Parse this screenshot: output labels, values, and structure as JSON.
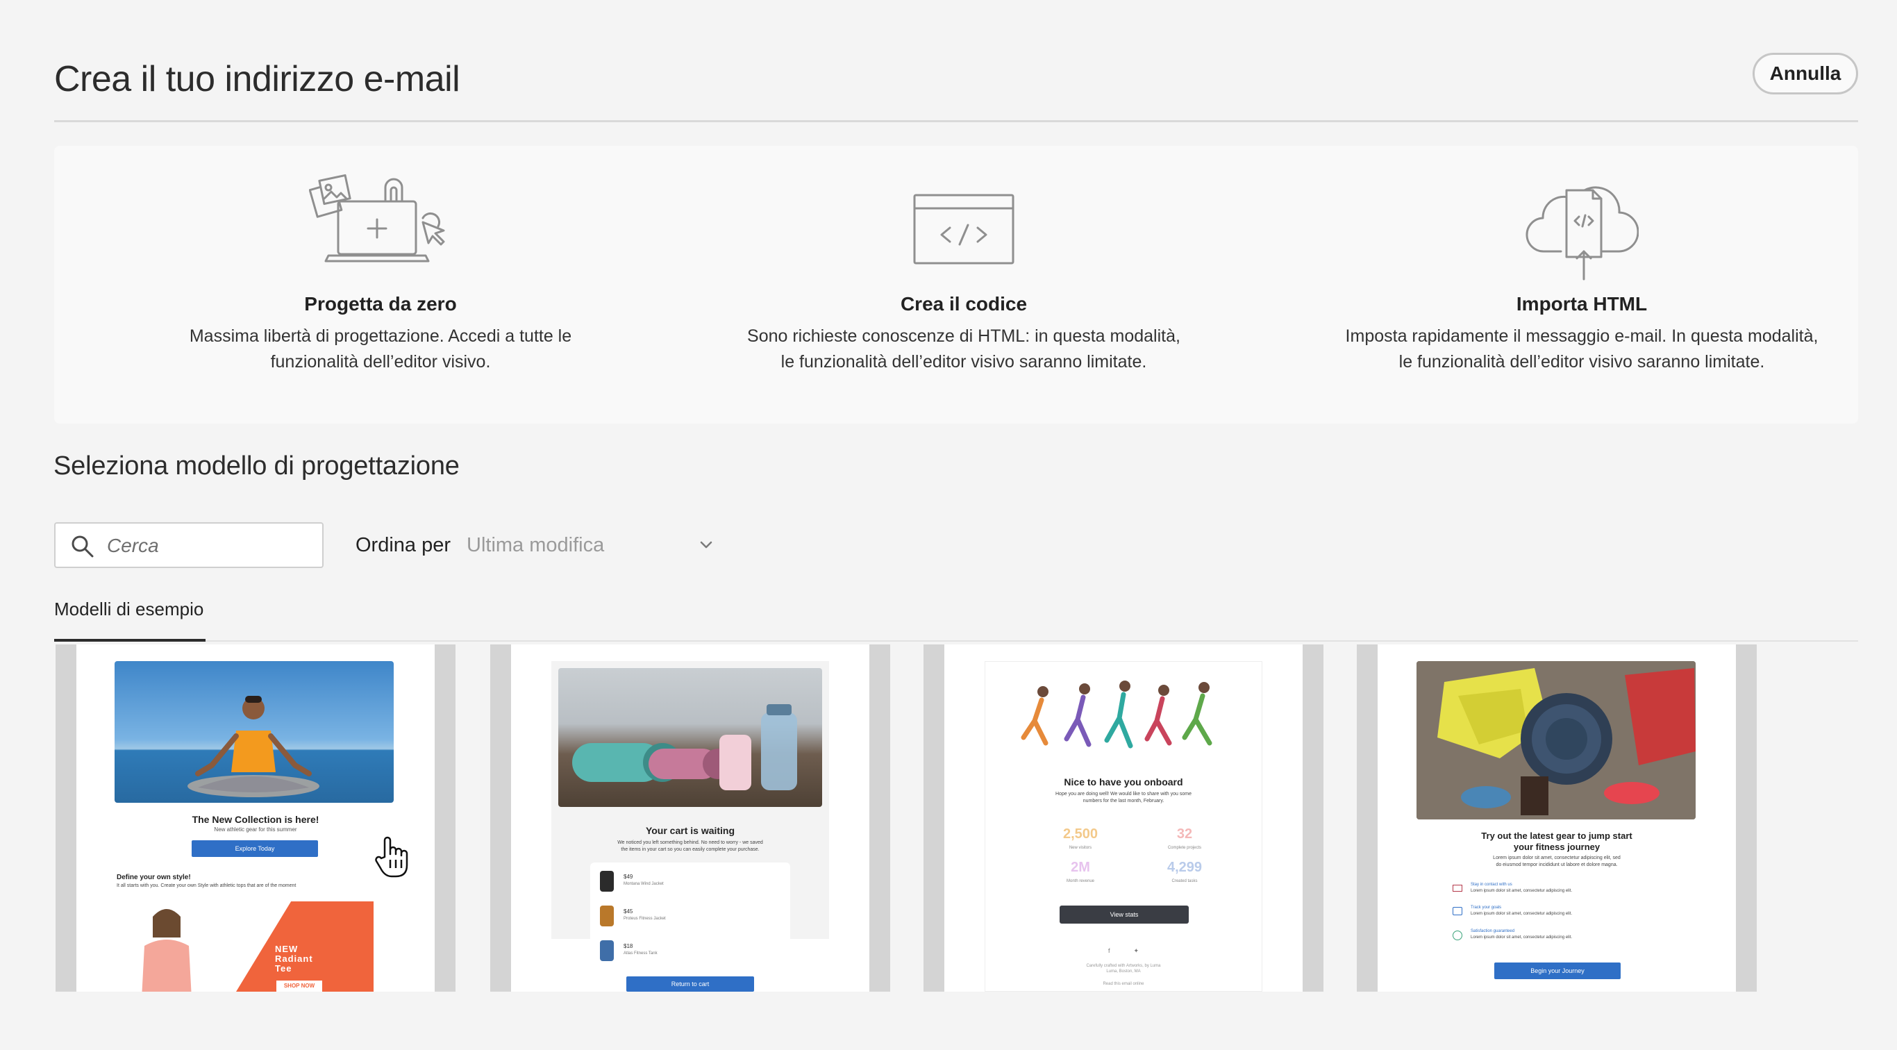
{
  "header": {
    "title": "Crea il tuo indirizzo e-mail",
    "cancel_label": "Annulla"
  },
  "options": [
    {
      "title": "Progetta da zero",
      "desc1": "Massima libertà di progettazione. Accedi a tutte le",
      "desc2": "funzionalità dell’editor visivo.",
      "icon": "design-canvas-icon"
    },
    {
      "title": "Crea il codice",
      "desc1": "Sono richieste conoscenze di HTML: in questa modalità,",
      "desc2": "le funzionalità dell’editor visivo saranno limitate.",
      "icon": "code-window-icon"
    },
    {
      "title": "Importa HTML",
      "desc1": "Imposta rapidamente il messaggio e-mail. In questa modalità,",
      "desc2": "le funzionalità dell’editor visivo saranno limitate.",
      "icon": "cloud-upload-code-icon"
    }
  ],
  "templates_section": {
    "title": "Seleziona modello di progettazione",
    "search_placeholder": "Cerca",
    "sort_label": "Ordina per",
    "sort_value": "Ultima modifica",
    "tabs": [
      "Modelli di esempio"
    ]
  },
  "templates": [
    {
      "headline": "The New Collection is here!",
      "sub": "New athletic gear for this summer",
      "button": "Explore Today",
      "section": "Define your own style!",
      "section_text": "It all starts with you. Create your own Style with athletic tops that are of the moment",
      "promo_line1": "NEW",
      "promo_line2": "Radiant",
      "promo_line3": "Tee",
      "promo_button": "SHOP NOW"
    },
    {
      "headline": "Your cart is waiting",
      "text1": "We noticed you left something behind. No need to worry - we saved",
      "text2": "the items in your cart so you can easily complete your purchase.",
      "items": [
        {
          "price": "$49",
          "name": "Montana Wind Jacket"
        },
        {
          "price": "$45",
          "name": "Proteus Fitness Jacket"
        },
        {
          "price": "$18",
          "name": "Atlas Fitness Tank"
        }
      ],
      "button": "Return to cart"
    },
    {
      "headline": "Nice to have you onboard",
      "text1": "Hope you are doing well! We would like to share with you some",
      "text2": "numbers for the last month, February.",
      "stats": [
        {
          "value": "2,500",
          "label": "New visitors",
          "color": "#f3c98a"
        },
        {
          "value": "32",
          "label": "Complete projects",
          "color": "#f4b8b8"
        },
        {
          "value": "2M",
          "label": "Month revenue",
          "color": "#e7c3ee"
        },
        {
          "value": "4,299",
          "label": "Created tasks",
          "color": "#b9cbea"
        }
      ],
      "button": "View stats",
      "footer1": "Carefully crafted with Artworks, by Luma",
      "footer2": "Luma, Boston, MA",
      "footer3": "Read this email online"
    },
    {
      "headline1": "Try out the latest gear to jump start",
      "headline2": "your fitness journey",
      "text1": "Lorem ipsum dolor sit amet, consectetur adipiscing elit, sed",
      "text2": "do eiusmod tempor incididunt ut labore et dolore magna.",
      "features": [
        {
          "title": "Stay in contact with us",
          "text": "Lorem ipsum dolor sit amet, consectetur adipiscing elit."
        },
        {
          "title": "Track your goals",
          "text": "Lorem ipsum dolor sit amet, consectetur adipiscing elit."
        },
        {
          "title": "Satisfaction guaranteed",
          "text": "Lorem ipsum dolor sit amet, consectetur adipiscing elit."
        }
      ],
      "button": "Begin your Journey"
    }
  ]
}
